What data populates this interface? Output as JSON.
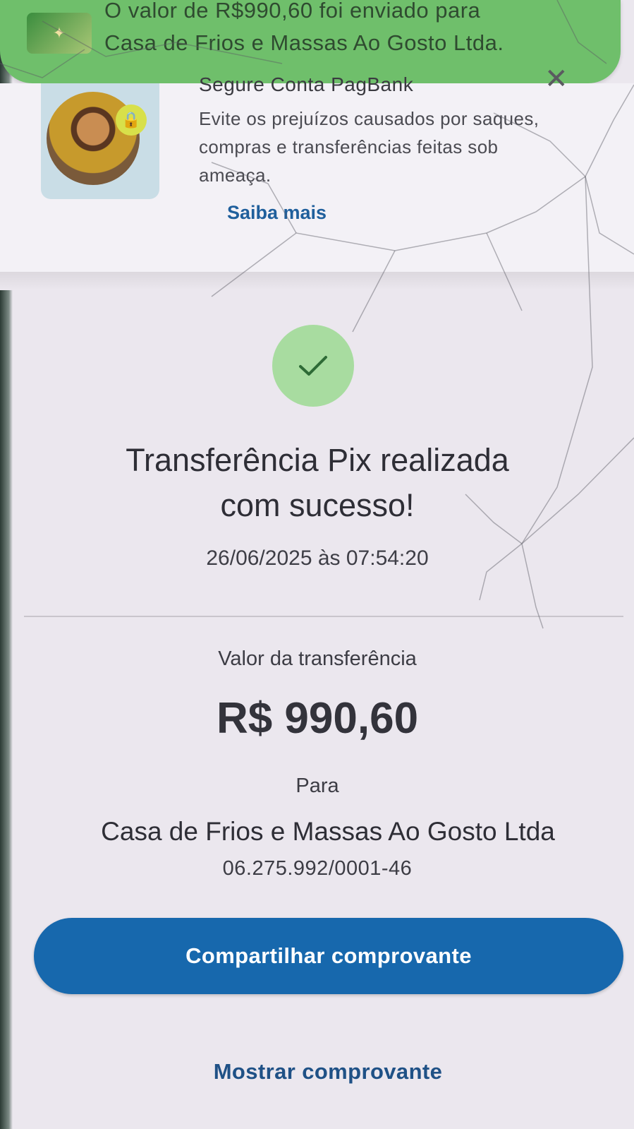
{
  "notification": {
    "line1": "O valor de R$990,60 foi enviado para",
    "line2": "Casa de Frios e Massas Ao Gosto Ltda.",
    "icon": "app-icon"
  },
  "security_card": {
    "title": "Segure Conta PagBank",
    "body": "Evite os prejuízos causados por saques, compras e transferências feitas sob ameaça.",
    "link": "Saiba mais",
    "close_icon": "close-icon",
    "badge_icon": "lock-icon"
  },
  "receipt": {
    "headline_line1": "Transferência Pix realizada",
    "headline_line2": "com sucesso!",
    "timestamp": "26/06/2025 às 07:54:20",
    "value_label": "Valor da transferência",
    "amount": "R$ 990,60",
    "to_label": "Para",
    "recipient_name": "Casa de Frios e Massas Ao Gosto Ltda",
    "recipient_document": "06.275.992/0001-46",
    "success_icon": "check-icon"
  },
  "actions": {
    "share_label": "Compartilhar comprovante",
    "show_label": "Mostrar comprovante"
  },
  "colors": {
    "notification_bg": "#6fbf6b",
    "primary_button": "#1768ad",
    "link": "#1f5f9c",
    "success_circle": "#a8dca0",
    "success_check": "#2e6b36"
  }
}
